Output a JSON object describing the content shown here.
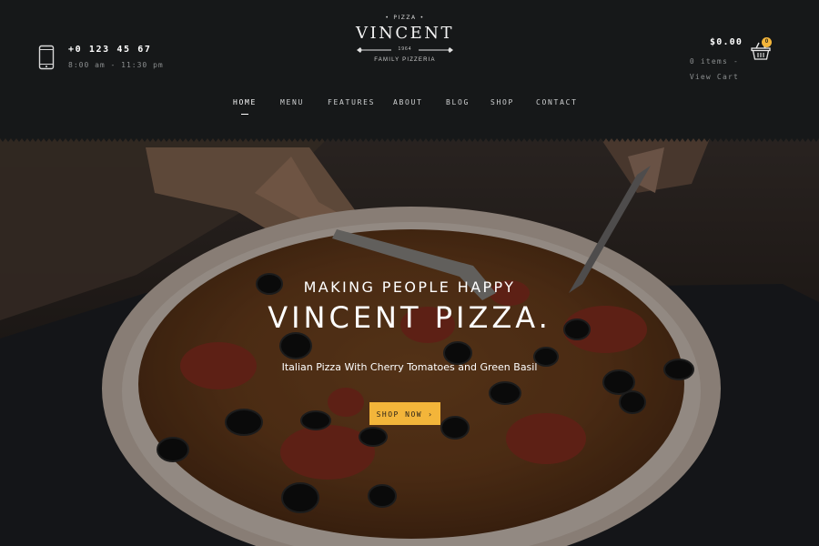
{
  "colors": {
    "header_bg": "#161819",
    "accent": "#f3b53a",
    "text_light": "#ffffff",
    "text_muted": "#8c8f90"
  },
  "contact": {
    "phone": "+0 123 45 67",
    "hours": "8:00 am - 11:30 pm",
    "icon": "smartphone-icon"
  },
  "logo": {
    "top": "PIZZA",
    "name": "VINCENT",
    "year": "1964",
    "bottom": "FAMILY PIZZERIA"
  },
  "cart": {
    "amount": "$0.00",
    "items": "0 items - View Cart",
    "badge": "0",
    "icon": "shopping-basket-icon"
  },
  "nav": {
    "items": [
      {
        "label": "HOME",
        "active": true
      },
      {
        "label": "MENU",
        "active": false
      },
      {
        "label": "FEATURES",
        "active": false
      },
      {
        "label": "ABOUT",
        "active": false
      },
      {
        "label": "BLOG",
        "active": false
      },
      {
        "label": "SHOP",
        "active": false
      },
      {
        "label": "CONTACT",
        "active": false
      }
    ]
  },
  "hero": {
    "kicker": "MAKING PEOPLE HAPPY",
    "title": "VINCENT PIZZA.",
    "subtitle": "Italian Pizza With Cherry Tomatoes and Green Basil",
    "button": "SHOP NOW",
    "button_icon": "chevron-right-icon"
  }
}
